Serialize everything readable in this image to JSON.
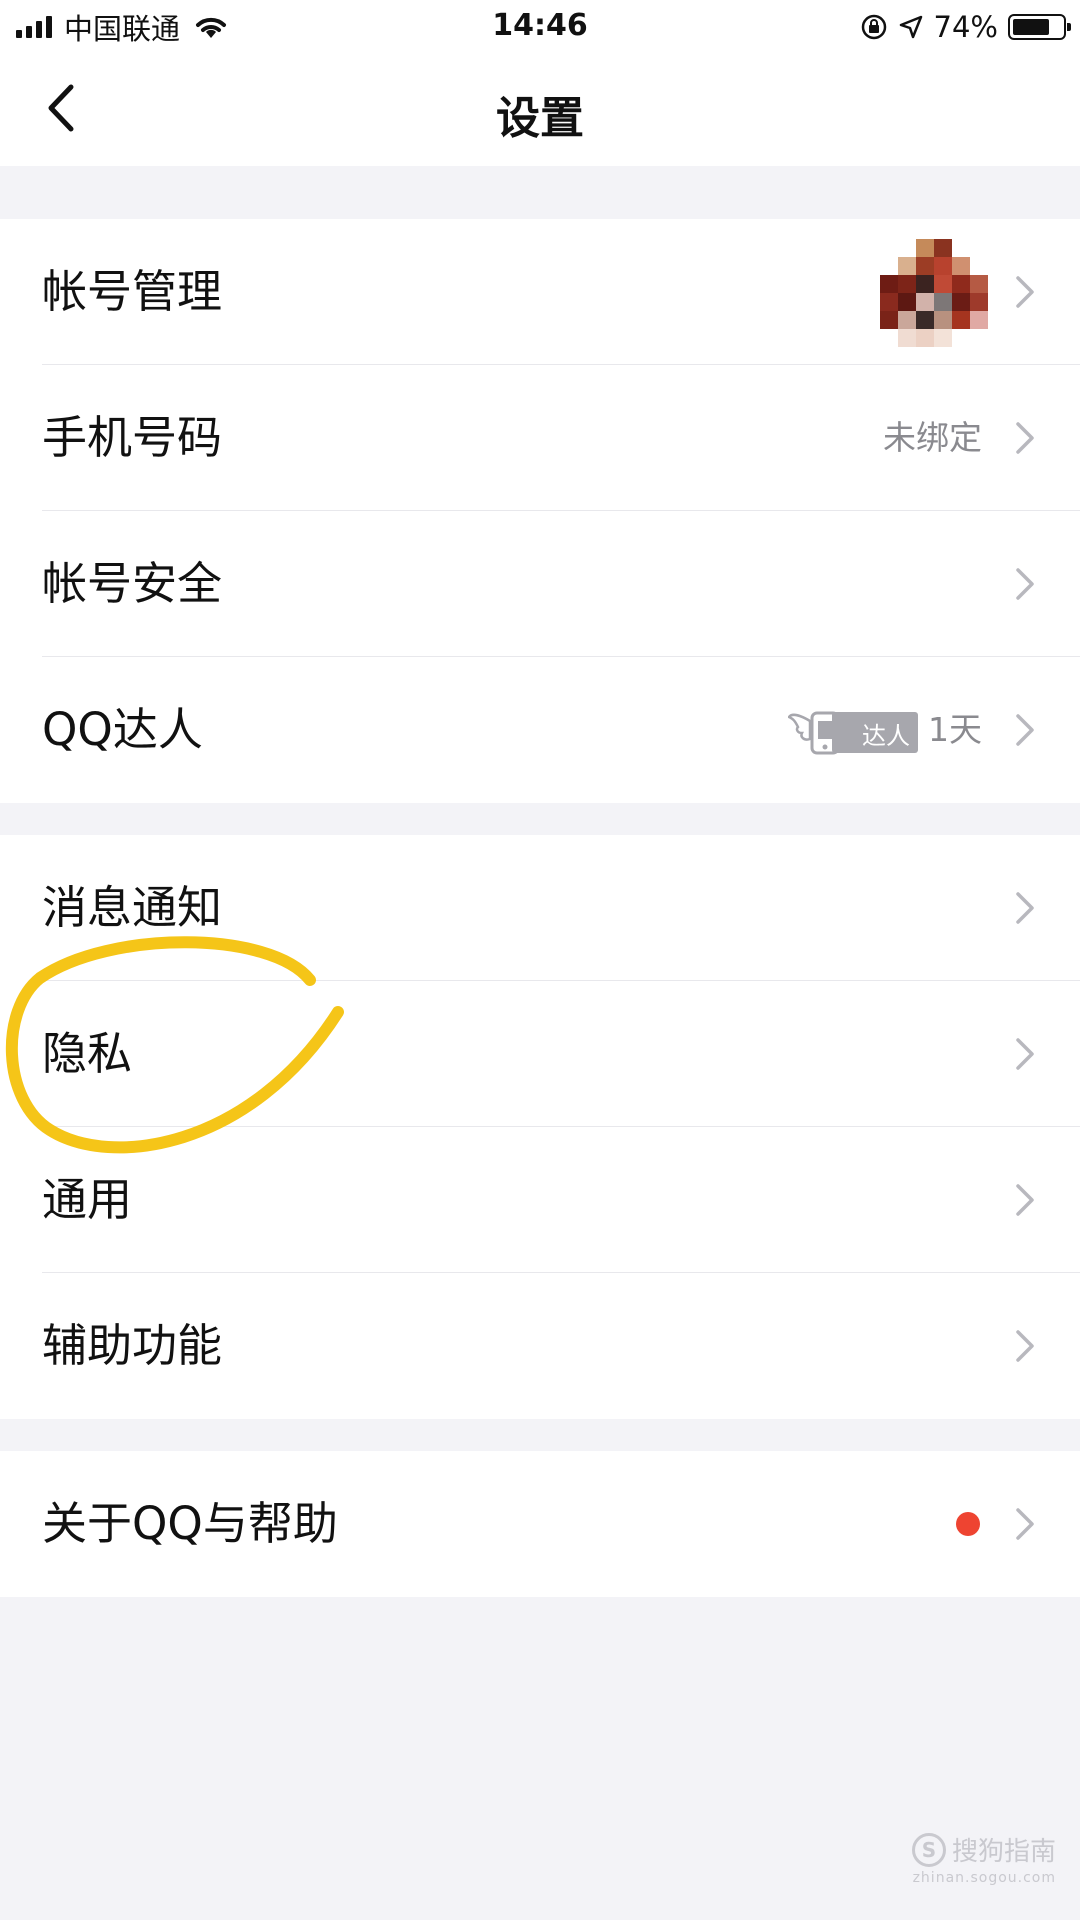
{
  "status_bar": {
    "carrier": "中国联通",
    "time": "14:46",
    "battery_percent": "74%",
    "battery_level": 0.74
  },
  "nav": {
    "title": "设置",
    "back_icon": "chevron-left-icon"
  },
  "groups": [
    {
      "rows": [
        {
          "label": "帐号管理",
          "value": "",
          "extra": "avatar"
        },
        {
          "label": "手机号码",
          "value": "未绑定"
        },
        {
          "label": "帐号安全",
          "value": ""
        },
        {
          "label": "QQ达人",
          "badge": "达人",
          "value": "1天"
        }
      ]
    },
    {
      "rows": [
        {
          "label": "消息通知"
        },
        {
          "label": "隐私"
        },
        {
          "label": "通用"
        },
        {
          "label": "辅助功能"
        }
      ]
    },
    {
      "rows": [
        {
          "label": "关于QQ与帮助",
          "extra": "red-dot"
        }
      ]
    }
  ],
  "watermark": {
    "text": "搜狗指南",
    "subtext": "zhinan.sogou.com"
  },
  "colors": {
    "background": "#f3f3f7",
    "highlight": "#f5c518",
    "red_dot": "#ee4431",
    "chevron": "#b8b8be"
  }
}
